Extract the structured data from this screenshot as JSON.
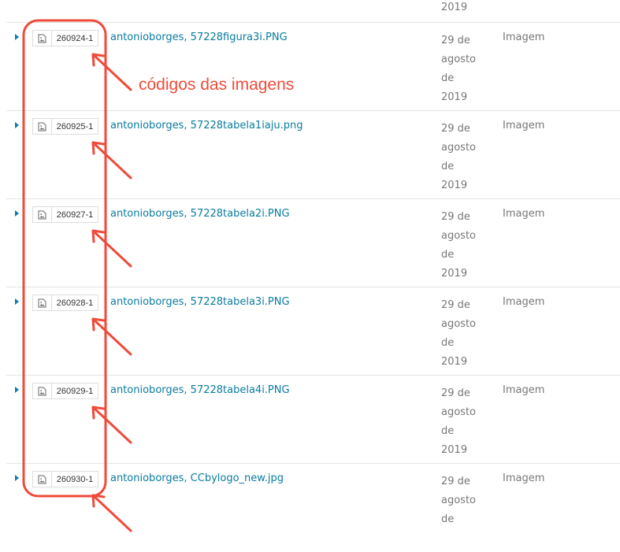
{
  "top_fragment": "2019",
  "rows": [
    {
      "code": "260924-1",
      "title": "antonioborges, 57228figura3i.PNG",
      "date": [
        "29 de",
        "agosto",
        "de",
        "2019"
      ],
      "type": "Imagem"
    },
    {
      "code": "260925-1",
      "title": "antonioborges, 57228tabela1iaju.png",
      "date": [
        "29 de",
        "agosto",
        "de",
        "2019"
      ],
      "type": "Imagem"
    },
    {
      "code": "260927-1",
      "title": "antonioborges, 57228tabela2i.PNG",
      "date": [
        "29 de",
        "agosto",
        "de",
        "2019"
      ],
      "type": "Imagem"
    },
    {
      "code": "260928-1",
      "title": "antonioborges, 57228tabela3i.PNG",
      "date": [
        "29 de",
        "agosto",
        "de",
        "2019"
      ],
      "type": "Imagem"
    },
    {
      "code": "260929-1",
      "title": "antonioborges, 57228tabela4i.PNG",
      "date": [
        "29 de",
        "agosto",
        "de",
        "2019"
      ],
      "type": "Imagem"
    },
    {
      "code": "260930-1",
      "title": "antonioborges, CCbylogo_new.jpg",
      "date": [
        "29 de",
        "agosto",
        "de"
      ],
      "type": "Imagem"
    }
  ],
  "annotation": {
    "label": "códigos das imagens",
    "color": "#f04a3a"
  },
  "icons": {
    "toggle": "triangle-right-icon",
    "file": "image-file-icon",
    "arrow": "arrow-icon"
  },
  "colors": {
    "link": "#0a7b9e",
    "toggle": "#0a7bb8",
    "annotation": "#f04a3a"
  }
}
